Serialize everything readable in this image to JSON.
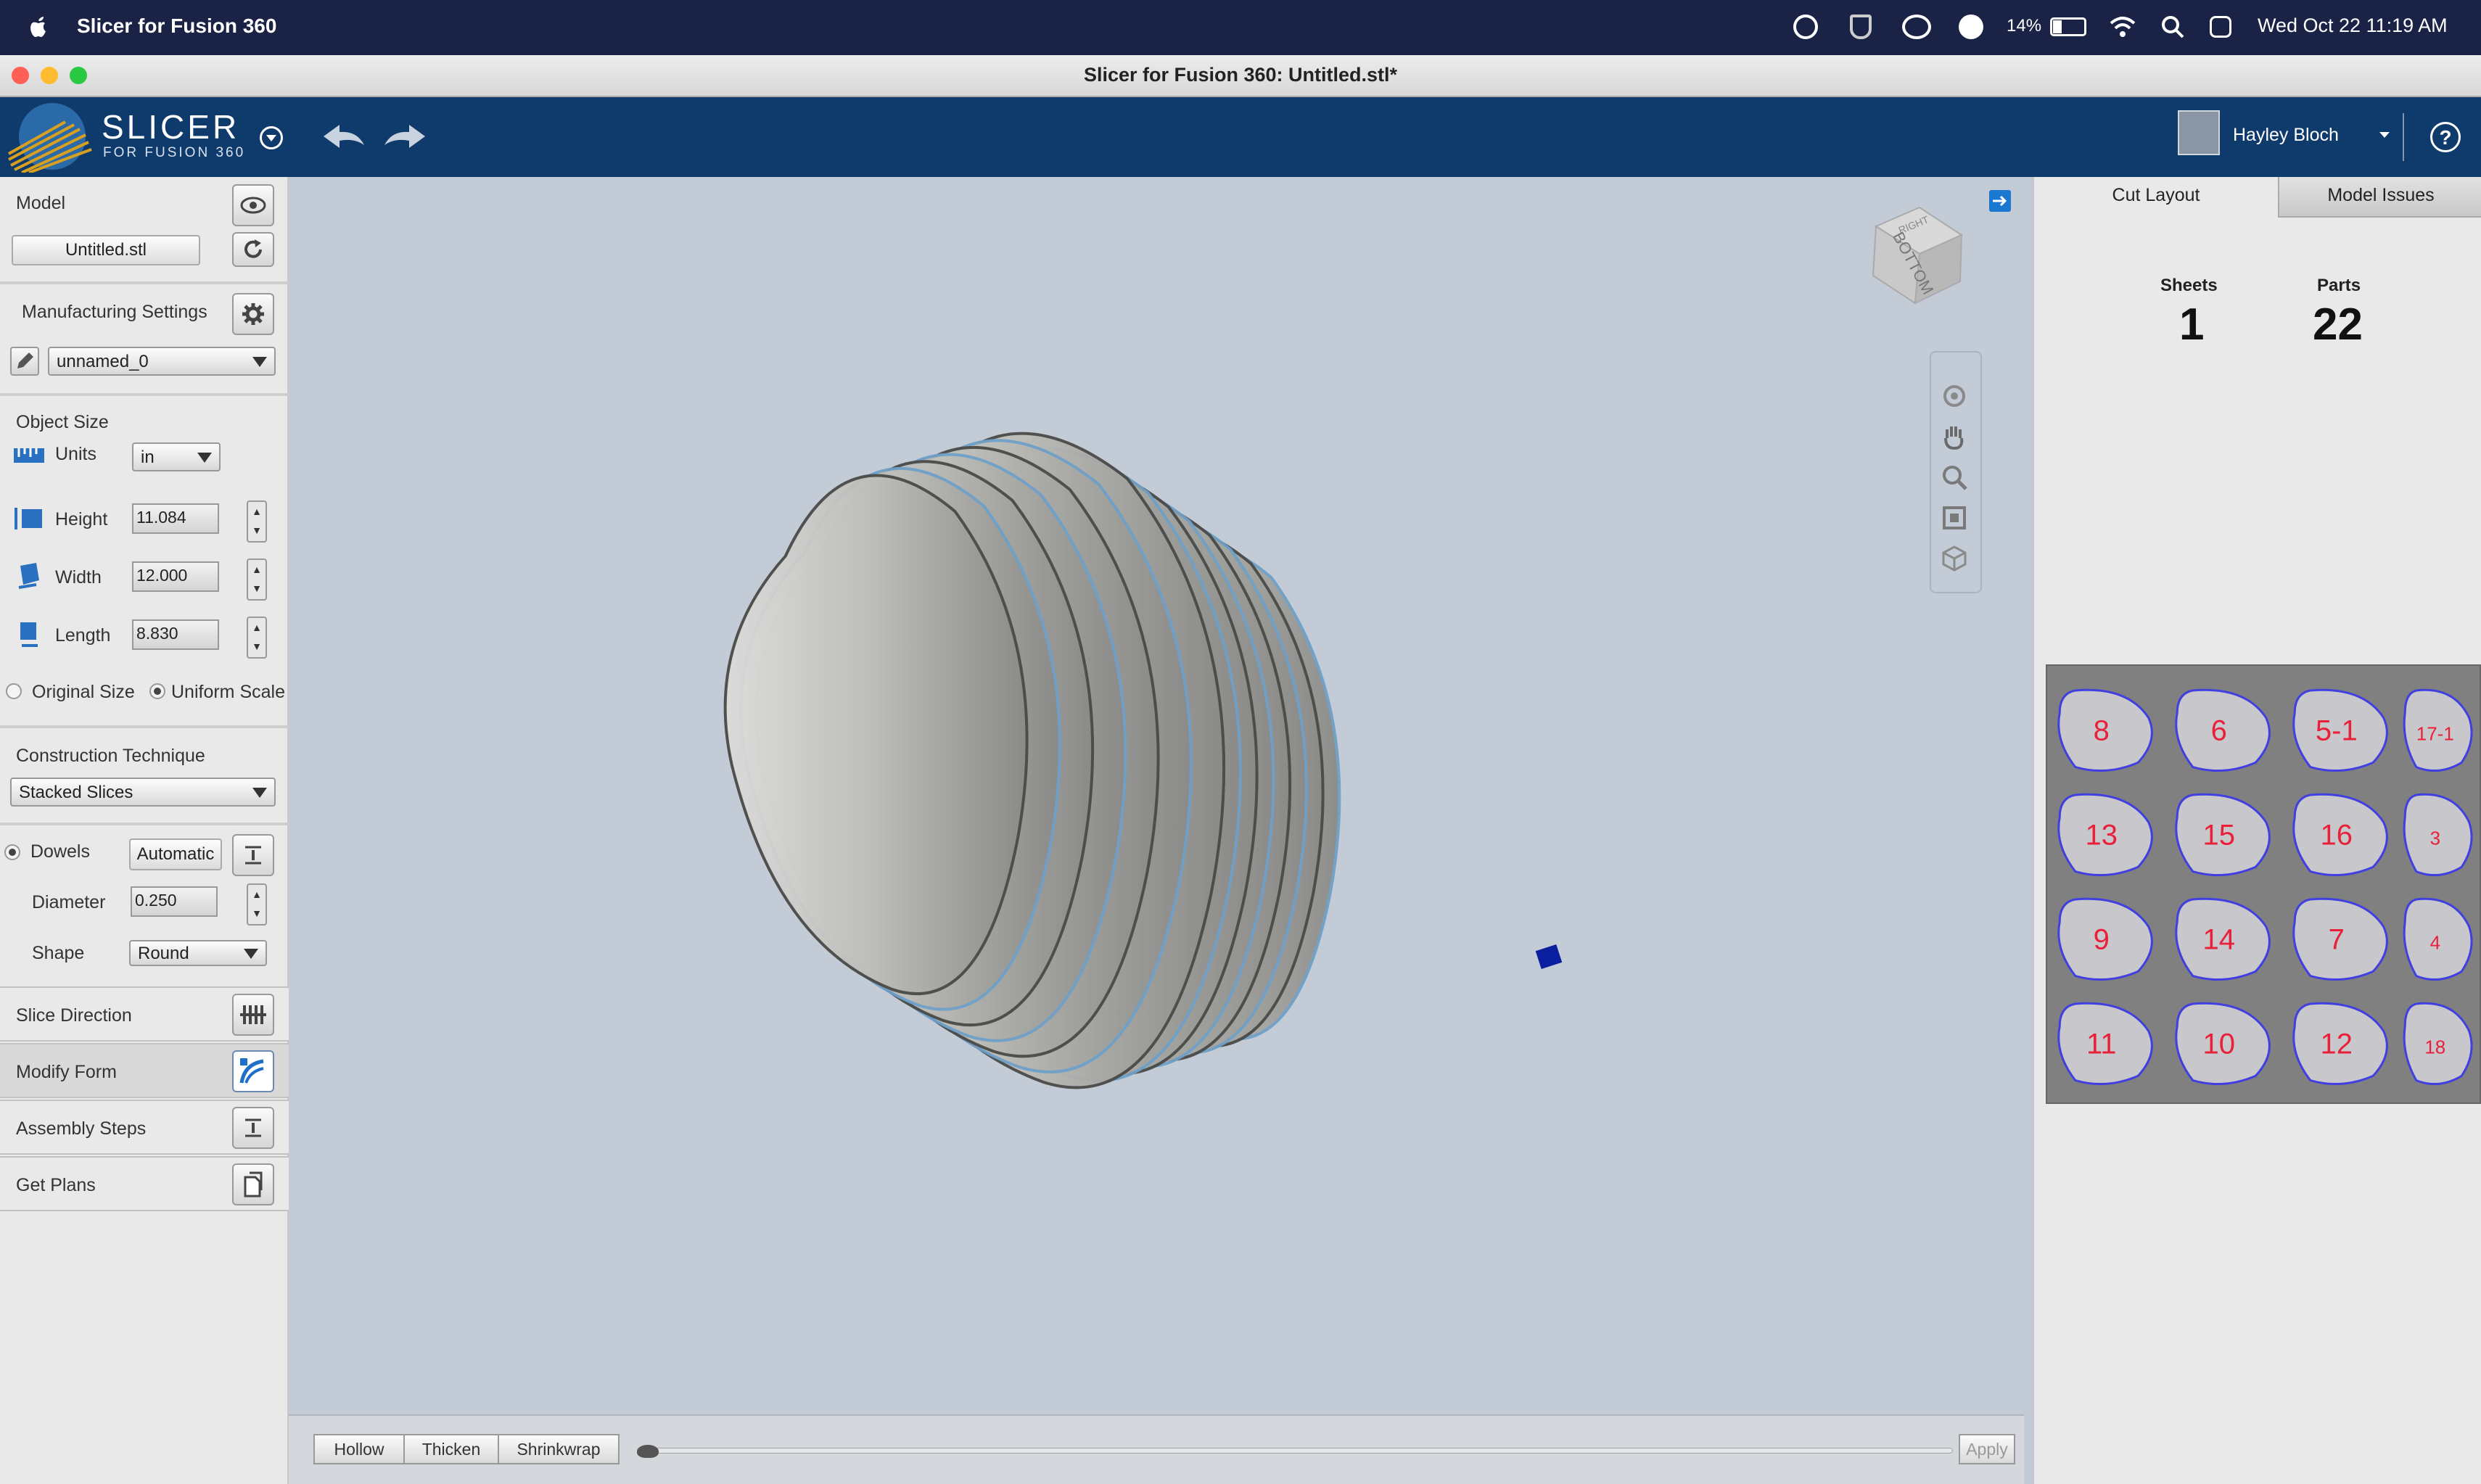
{
  "menubar": {
    "app_name": "Slicer for Fusion 360",
    "battery": "14%",
    "datetime": "Wed Oct 22  11:19 AM"
  },
  "window": {
    "title": "Slicer for Fusion 360: Untitled.stl*"
  },
  "toolbar": {
    "logo_main": "SLICER",
    "logo_sub": "FOR FUSION 360",
    "user_name": "Hayley Bloch"
  },
  "model": {
    "heading": "Model",
    "file_button": "Untitled.stl"
  },
  "manufacturing": {
    "heading": "Manufacturing Settings",
    "preset": "unnamed_0"
  },
  "object_size": {
    "heading": "Object Size",
    "units_label": "Units",
    "units_value": "in",
    "height_label": "Height",
    "height_value": "11.084",
    "width_label": "Width",
    "width_value": "12.000",
    "length_label": "Length",
    "length_value": "8.830",
    "original_size": "Original Size",
    "uniform_scale": "Uniform Scale"
  },
  "construction": {
    "heading": "Construction Technique",
    "technique": "Stacked Slices"
  },
  "dowels": {
    "label": "Dowels",
    "mode": "Automatic",
    "diameter_label": "Diameter",
    "diameter_value": "0.250",
    "shape_label": "Shape",
    "shape_value": "Round"
  },
  "sections": {
    "slice_direction": "Slice Direction",
    "modify_form": "Modify Form",
    "assembly_steps": "Assembly Steps",
    "get_plans": "Get Plans"
  },
  "viewcube": {
    "top_face": "RIGHT",
    "front_face": "BOTTOM"
  },
  "modify_bar": {
    "hollow": "Hollow",
    "thicken": "Thicken",
    "shrinkwrap": "Shrinkwrap",
    "apply": "Apply"
  },
  "right_panel": {
    "tabs": [
      "Cut Layout",
      "Model Issues"
    ],
    "sheets_label": "Sheets",
    "sheets_value": "1",
    "parts_label": "Parts",
    "parts_value": "22"
  },
  "sheet_parts": [
    "8",
    "6",
    "5-1",
    "17-1",
    "13",
    "15",
    "16",
    "3",
    "9",
    "14",
    "7",
    "4",
    "11",
    "10",
    "12",
    "18"
  ],
  "colors": {
    "accent": "#0f3a6c",
    "menubar": "#1a2346",
    "part_outline": "#4040e0",
    "part_label": "#e8203a"
  }
}
